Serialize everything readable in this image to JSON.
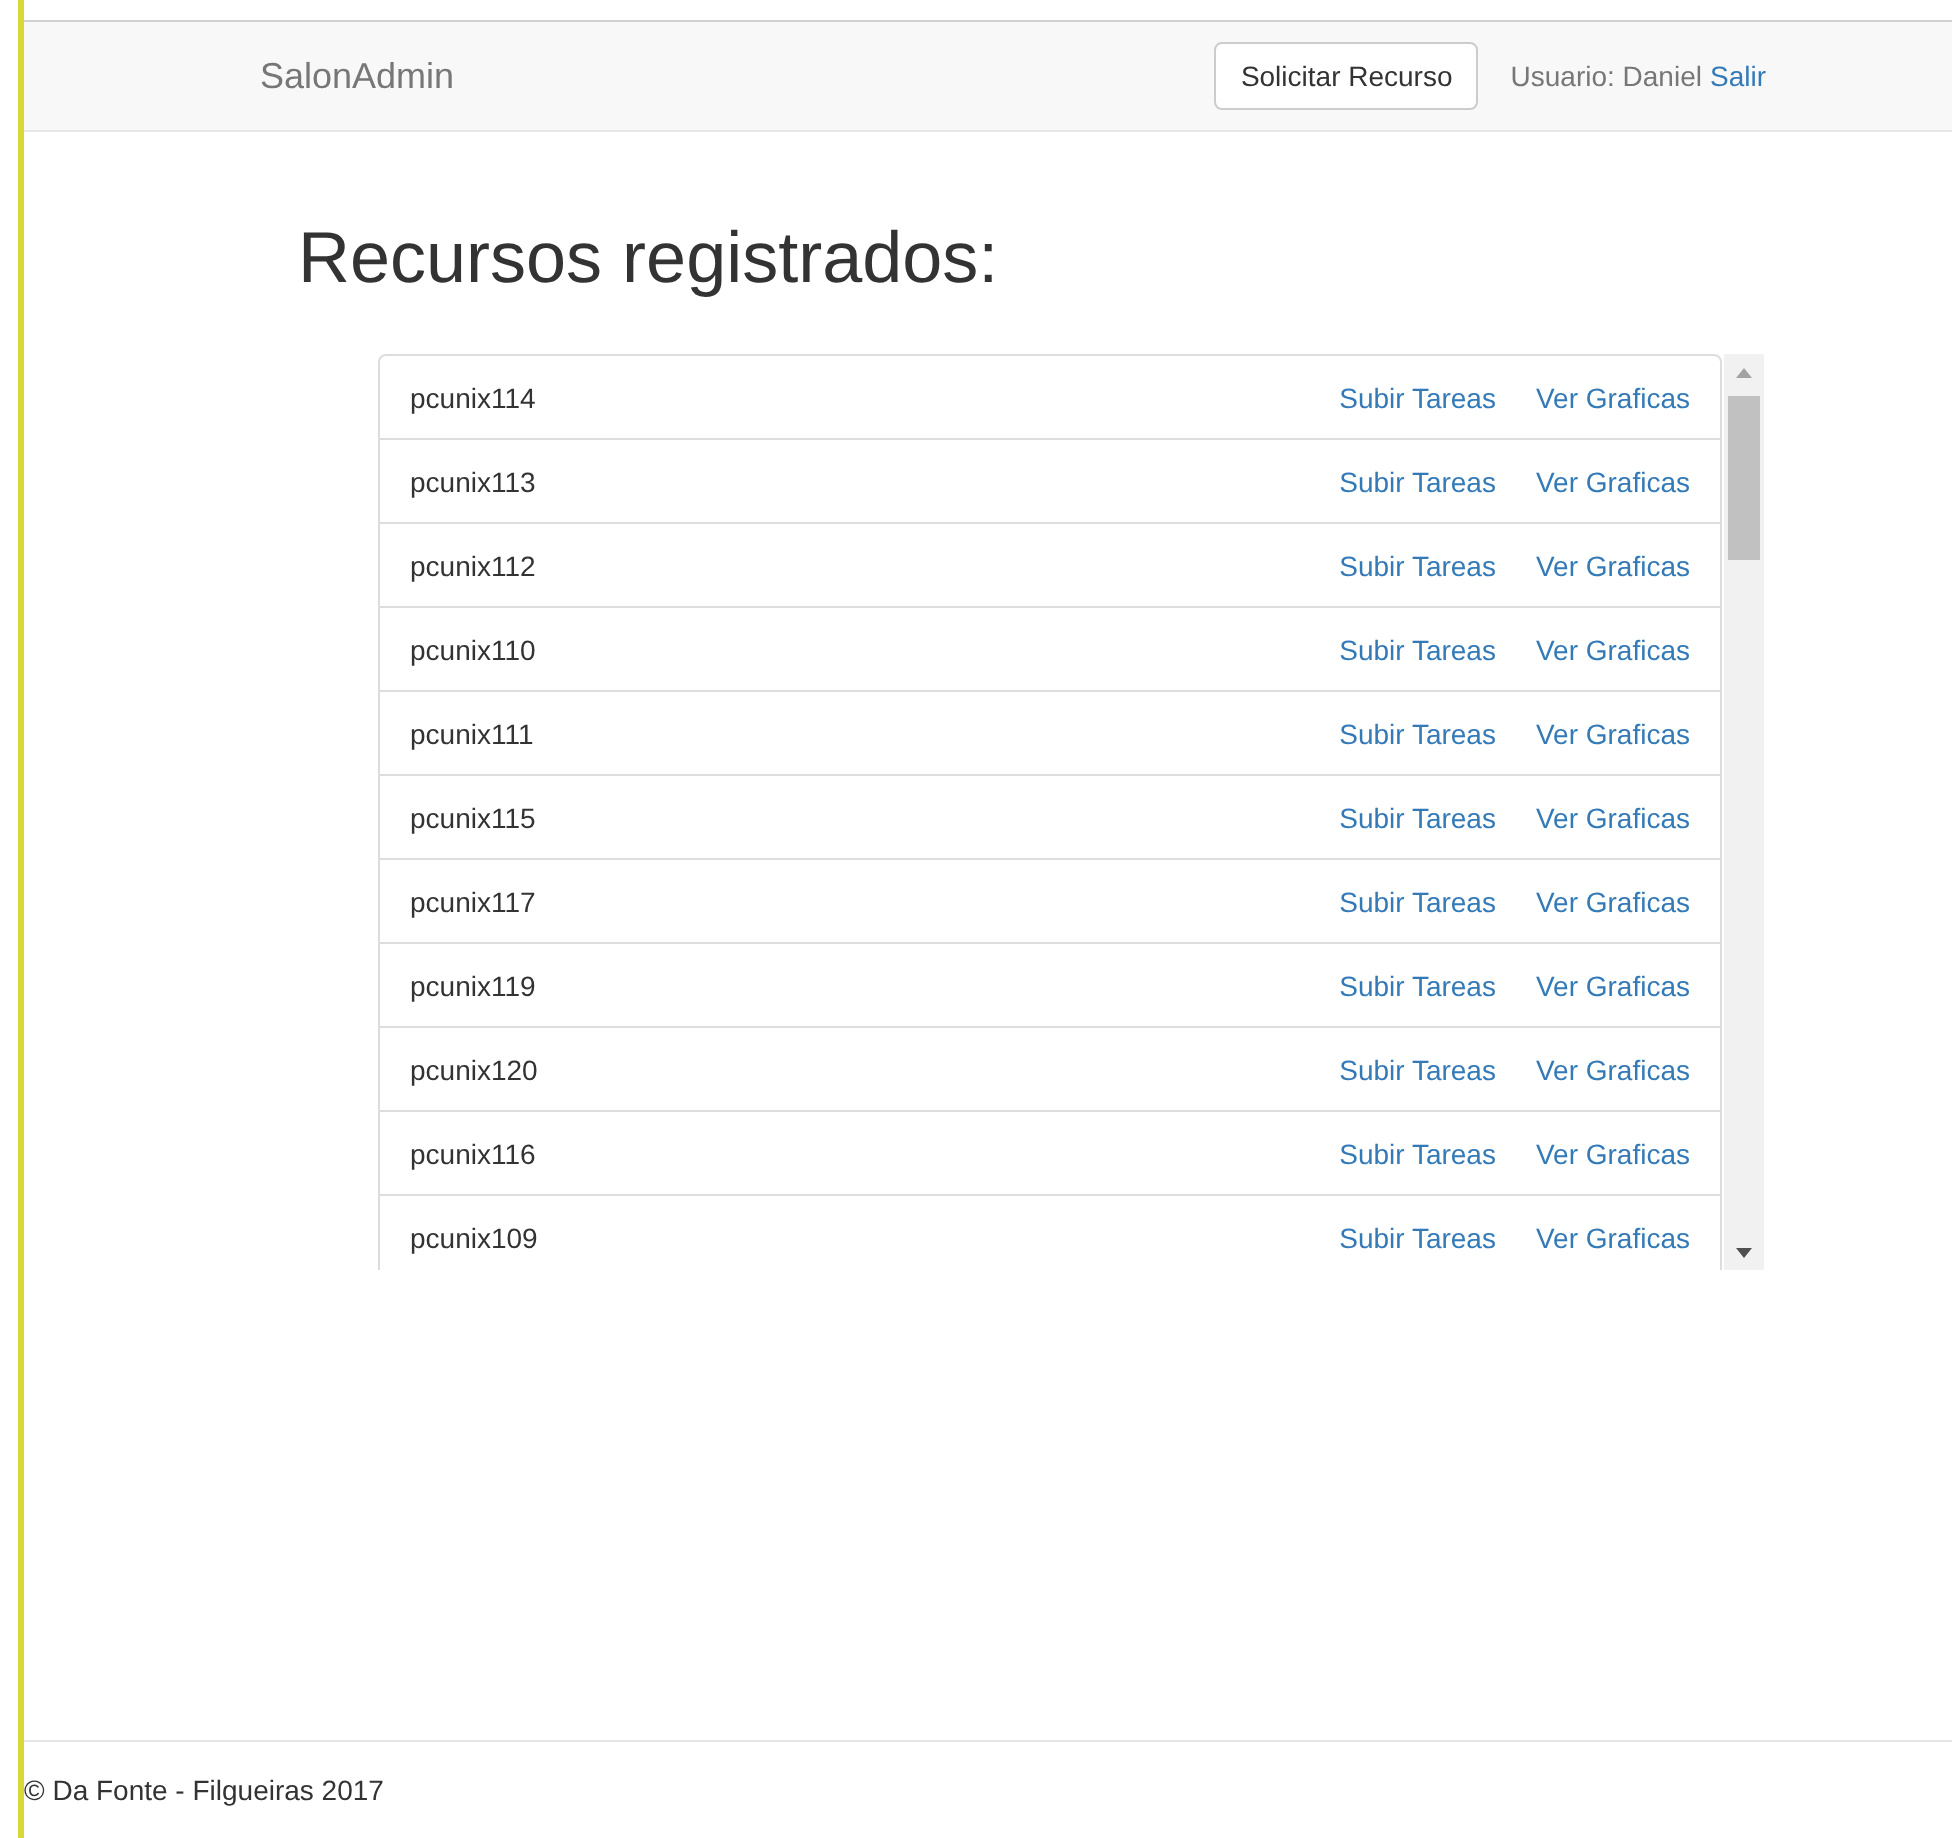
{
  "navbar": {
    "brand": "SalonAdmin",
    "request_button": "Solicitar Recurso",
    "user_label": "Usuario: Daniel",
    "logout_link": "Salir"
  },
  "heading": "Recursos registrados:",
  "resources": [
    {
      "name": "pcunix114",
      "upload_link": "Subir Tareas",
      "charts_link": "Ver Graficas"
    },
    {
      "name": "pcunix113",
      "upload_link": "Subir Tareas",
      "charts_link": "Ver Graficas"
    },
    {
      "name": "pcunix112",
      "upload_link": "Subir Tareas",
      "charts_link": "Ver Graficas"
    },
    {
      "name": "pcunix110",
      "upload_link": "Subir Tareas",
      "charts_link": "Ver Graficas"
    },
    {
      "name": "pcunix111",
      "upload_link": "Subir Tareas",
      "charts_link": "Ver Graficas"
    },
    {
      "name": "pcunix115",
      "upload_link": "Subir Tareas",
      "charts_link": "Ver Graficas"
    },
    {
      "name": "pcunix117",
      "upload_link": "Subir Tareas",
      "charts_link": "Ver Graficas"
    },
    {
      "name": "pcunix119",
      "upload_link": "Subir Tareas",
      "charts_link": "Ver Graficas"
    },
    {
      "name": "pcunix120",
      "upload_link": "Subir Tareas",
      "charts_link": "Ver Graficas"
    },
    {
      "name": "pcunix116",
      "upload_link": "Subir Tareas",
      "charts_link": "Ver Graficas"
    },
    {
      "name": "pcunix109",
      "upload_link": "Subir Tareas",
      "charts_link": "Ver Graficas"
    }
  ],
  "footer": "© Da Fonte - Filgueiras 2017"
}
